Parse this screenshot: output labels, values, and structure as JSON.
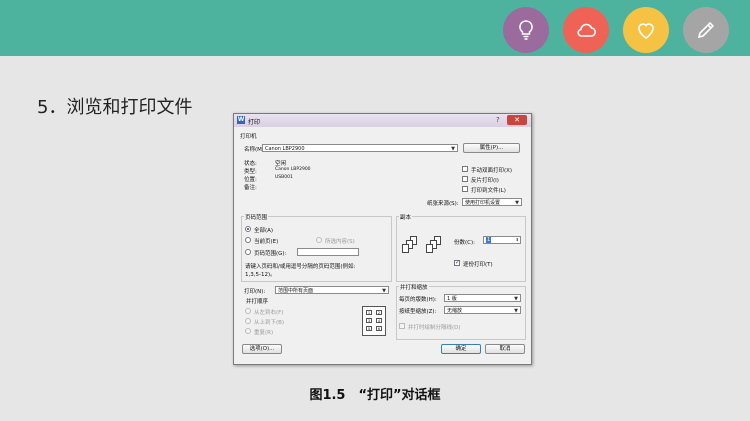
{
  "slide": {
    "title": "5．浏览和打印文件",
    "caption": "图1.5　“打印”对话框",
    "header_icons": [
      {
        "name": "lightbulb-icon",
        "color": "#9b6b9e"
      },
      {
        "name": "cloud-icon",
        "color": "#ef6356"
      },
      {
        "name": "heart-icon",
        "color": "#f6c244"
      },
      {
        "name": "pencil-icon",
        "color": "#a5a5a5"
      }
    ]
  },
  "dialog": {
    "app_icon": "W",
    "title": "打印",
    "help": "?",
    "close": "✕",
    "printer": {
      "section": "打印机",
      "name_label": "名称(M):",
      "name_value": "Canon LBP2900",
      "properties_button": "属性(P)...",
      "status_label": "状态:",
      "status_value": "空闲",
      "type_label": "类型:",
      "type_value": "Canon LBP2900",
      "where_label": "位置:",
      "where_value": "USB001",
      "comment_label": "备注:",
      "duplex_manual": "手动双面打印(X)",
      "reverse_print": "反片打印(I)",
      "print_to_file": "打印到文件(L)",
      "paper_source_label": "纸张来源(S):",
      "paper_source_value": "使用打印机设置"
    },
    "range": {
      "section": "页码范围",
      "all": "全部(A)",
      "current": "当前页(E)",
      "selection": "所选内容(S)",
      "pages": "页码范围(G):",
      "hint_line1": "请键入页码和/或用逗号分隔的页码范围(例如:",
      "hint_line2": "1,3,5-12)。"
    },
    "copies": {
      "section": "副本",
      "count_label": "份数(C):",
      "count_value": "1",
      "collate": "逐份打印(T)"
    },
    "print_what": {
      "label": "打印(N):",
      "value": "范围中所有页面"
    },
    "order": {
      "section": "并打顺序",
      "left_to_right": "从左到右(F)",
      "top_to_bottom": "从上到下(B)",
      "repeat": "重复(R)",
      "cells": [
        "1",
        "2",
        "3",
        "4",
        "5",
        "6"
      ]
    },
    "zoom": {
      "section": "并打和缩放",
      "pages_per_sheet_label": "每页的版数(H):",
      "pages_per_sheet_value": "1 版",
      "scale_label": "按纸型缩放(Z):",
      "scale_value": "无缩放",
      "draw_borders": "并打时绘制分隔线(D)"
    },
    "buttons": {
      "options": "选项(O)...",
      "ok": "确定",
      "cancel": "取消"
    }
  }
}
